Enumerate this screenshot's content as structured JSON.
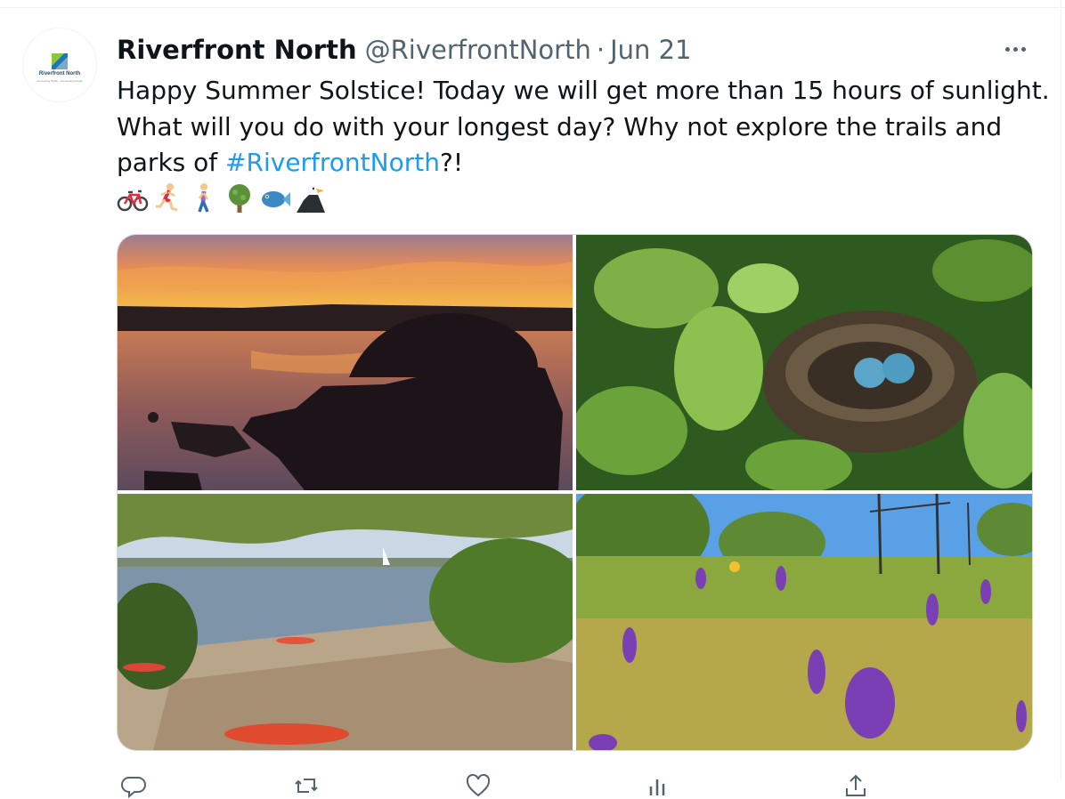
{
  "tweet": {
    "author_name": "Riverfront North",
    "handle": "@RiverfrontNorth",
    "separator": "·",
    "date": "Jun 21",
    "avatar_text": "Riverfront North",
    "avatar_tagline": "Connecting Parks · Connecting People",
    "text_line1": "Happy Summer Solstice! Today we will get more than 15 hours of sunlight.",
    "text_line2": "What will you do with your longest day? Why not explore the trails and",
    "text_line3_before": "parks of ",
    "hashtag": "#RiverfrontNorth",
    "text_line3_after": "?!",
    "emojis": [
      "bicycle-icon",
      "person-running-icon",
      "person-walking-icon",
      "tree-icon",
      "fish-icon",
      "eagle-icon"
    ]
  },
  "media": [
    {
      "name": "sunset-river-photo"
    },
    {
      "name": "robin-nest-photo"
    },
    {
      "name": "riverbank-kayaks-photo"
    },
    {
      "name": "wildflower-meadow-photo"
    }
  ],
  "actions": [
    "reply-icon",
    "retweet-icon",
    "like-icon",
    "views-icon",
    "share-icon"
  ],
  "colors": {
    "accent": "#1d9bf0",
    "text": "#0f1419",
    "muted": "#536471",
    "border": "#cfd9de"
  }
}
